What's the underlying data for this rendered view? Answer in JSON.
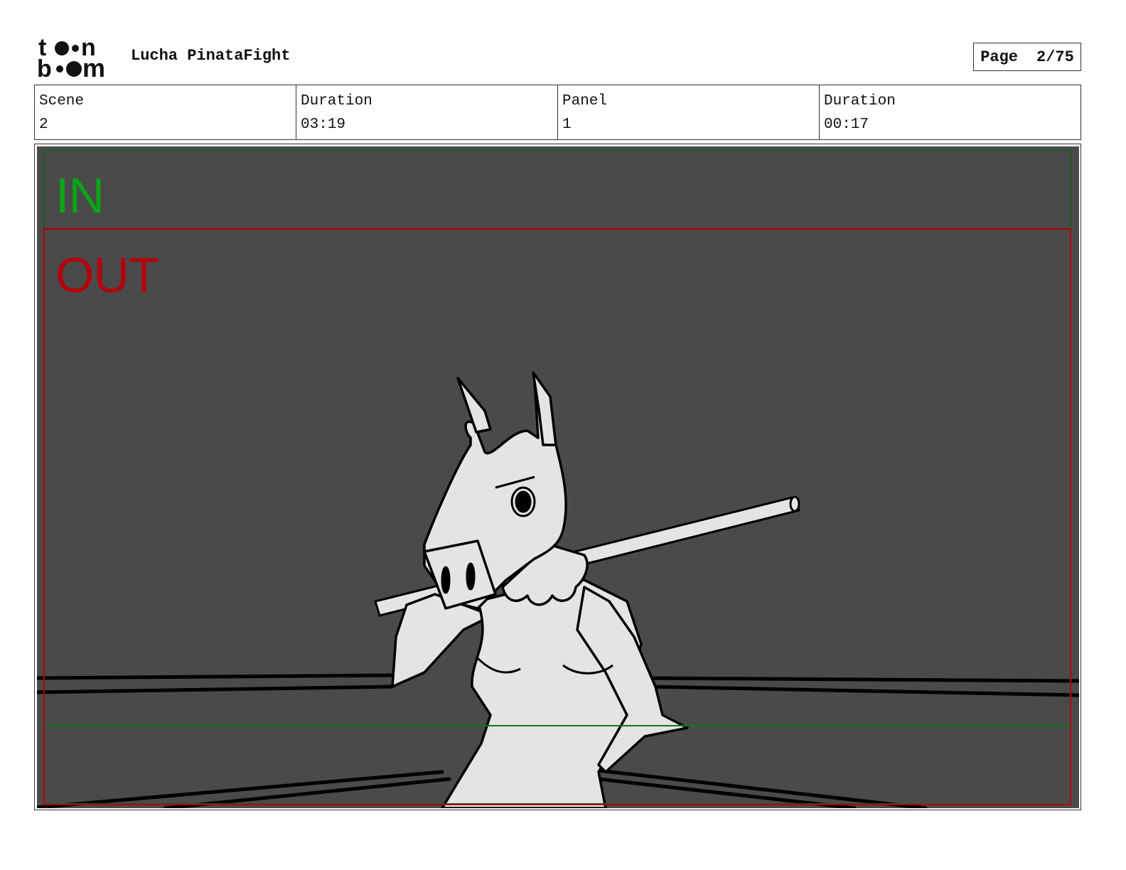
{
  "header": {
    "logo_text": "toon boom",
    "project_title": "Lucha PinataFight",
    "page_label": "Page",
    "page_value": "2/75"
  },
  "info": {
    "scene_label": "Scene",
    "scene_value": "2",
    "scene_duration_label": "Duration",
    "scene_duration_value": "03:19",
    "panel_label": "Panel",
    "panel_value": "1",
    "panel_duration_label": "Duration",
    "panel_duration_value": "00:17"
  },
  "panel": {
    "in_label": "IN",
    "out_label": "OUT",
    "colors": {
      "background": "#4a4a4a",
      "in_frame": "#0aa516",
      "out_frame": "#b3000c",
      "sketch_fill": "#e4e4e4",
      "sketch_line": "#000000"
    }
  }
}
